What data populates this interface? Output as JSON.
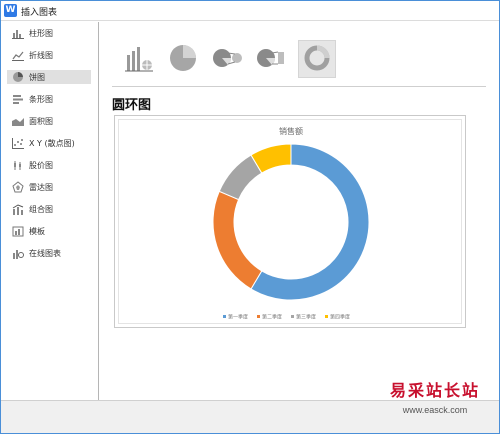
{
  "window": {
    "title": "插入图表",
    "app_icon_letter": "W"
  },
  "sidebar": {
    "items": [
      {
        "label": "柱形图",
        "icon": "column-chart-icon",
        "active": false
      },
      {
        "label": "折线图",
        "icon": "line-chart-icon",
        "active": false
      },
      {
        "label": "饼图",
        "icon": "pie-chart-icon",
        "active": true
      },
      {
        "label": "条形图",
        "icon": "bar-chart-icon",
        "active": false
      },
      {
        "label": "面积图",
        "icon": "area-chart-icon",
        "active": false
      },
      {
        "label": "X Y (散点图)",
        "icon": "scatter-chart-icon",
        "active": false
      },
      {
        "label": "股价图",
        "icon": "stock-chart-icon",
        "active": false
      },
      {
        "label": "雷达图",
        "icon": "radar-chart-icon",
        "active": false
      },
      {
        "label": "组合图",
        "icon": "combo-chart-icon",
        "active": false
      },
      {
        "label": "模板",
        "icon": "template-icon",
        "active": false
      },
      {
        "label": "在线图表",
        "icon": "online-chart-icon",
        "active": false
      }
    ]
  },
  "main": {
    "subtypes": [
      {
        "icon": "chart-thumbnail-icon",
        "active": false
      },
      {
        "icon": "pie-icon",
        "active": false
      },
      {
        "icon": "pie-of-pie-icon",
        "active": false
      },
      {
        "icon": "bar-of-pie-icon",
        "active": false
      },
      {
        "icon": "doughnut-icon",
        "active": true
      }
    ],
    "section_title": "圆环图"
  },
  "colors": {
    "accent": "#4a8fd8",
    "series": [
      "#5b9bd5",
      "#ed7d31",
      "#a5a5a5",
      "#ffc000"
    ]
  },
  "chart_data": {
    "type": "pie",
    "variant": "doughnut",
    "title": "销售额",
    "categories": [
      "第一季度",
      "第二季度",
      "第三季度",
      "第四季度"
    ],
    "values": [
      8.2,
      3.2,
      1.4,
      1.2
    ],
    "legend_position": "bottom"
  },
  "watermark": {
    "text": "易采站长站",
    "url": "www.easck.com"
  }
}
